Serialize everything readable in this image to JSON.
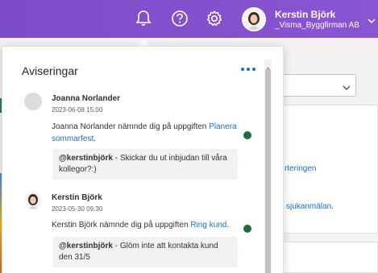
{
  "header": {
    "user_name": "Kerstin Björk",
    "user_company": "_Visma_Byggfirman AB",
    "icons": [
      "bell-icon",
      "help-icon",
      "gear-icon"
    ],
    "accent": "#7d4cc9"
  },
  "background": {
    "link1": "rteringen",
    "link2": "sjukanmälan."
  },
  "panel": {
    "title": "Aviseringar"
  },
  "notifications": [
    {
      "name": "Joanna Norlander",
      "date": "2023-06-08 15:00",
      "text_before": "Joanna Norlander nämnde dig på uppgiften ",
      "link": "Planera sommarfest",
      "text_after": ".",
      "mention": "@kerstinbjörk",
      "quote": " - Skickar du ut inbjudan till våra kollegor?:)",
      "unread": true
    },
    {
      "name": "Kerstin Björk",
      "date": "2023-05-30 09:30",
      "text_before": "Kerstin Björk nämnde dig på uppgiften ",
      "link": "Ring kund",
      "text_after": ".",
      "mention": "@kerstinbjörk",
      "quote": " - Glöm inte att kontakta kund den 31/5",
      "unread": true
    }
  ]
}
